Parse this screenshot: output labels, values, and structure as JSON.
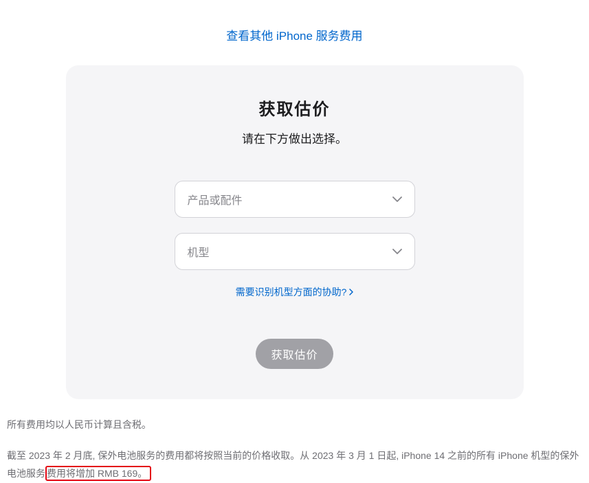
{
  "top_link": {
    "label": "查看其他 iPhone 服务费用"
  },
  "card": {
    "title": "获取估价",
    "subtitle": "请在下方做出选择。",
    "select_product": {
      "placeholder": "产品或配件"
    },
    "select_model": {
      "placeholder": "机型"
    },
    "help_link": {
      "label": "需要识别机型方面的协助?"
    },
    "submit_button": {
      "label": "获取估价"
    }
  },
  "footer": {
    "line1": "所有费用均以人民币计算且含税。",
    "line2_part1": "截至 2023 年 2 月底, 保外电池服务的费用都将按照当前的价格收取。从 2023 年 3 月 1 日起, iPhone 14 之前的所有 iPhone 机型的保外电池服务",
    "line2_highlight": "费用将增加 RMB 169。"
  }
}
